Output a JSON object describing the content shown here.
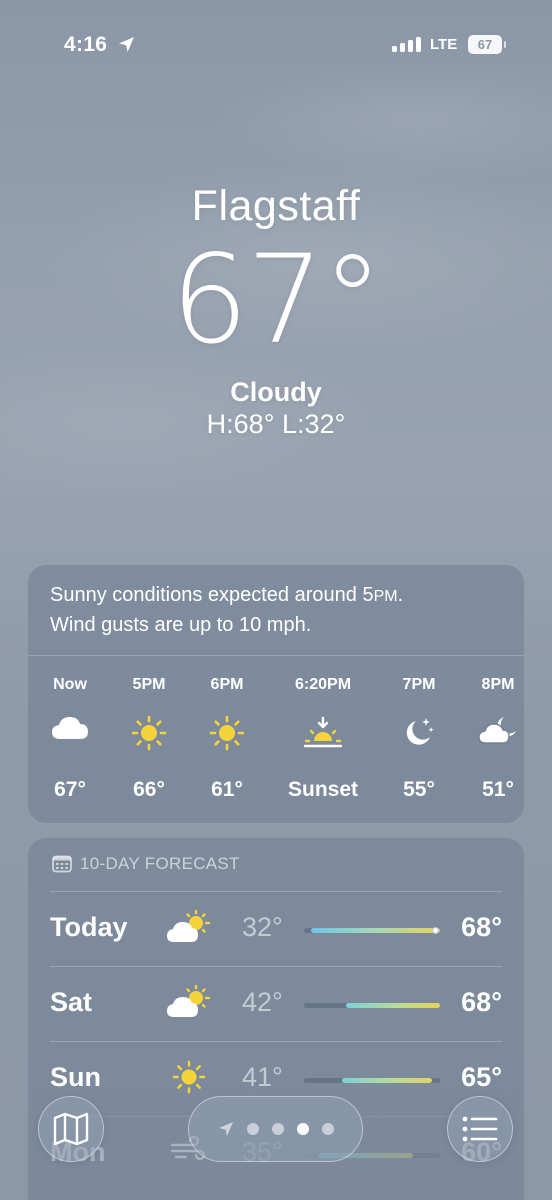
{
  "status_bar": {
    "time": "4:16",
    "network": "LTE",
    "battery": "67"
  },
  "location": {
    "city": "Flagstaff",
    "temperature": "67°",
    "condition": "Cloudy",
    "high_low": "H:68°  L:32°"
  },
  "hourly": {
    "summary_line1_a": "Sunny conditions expected around 5",
    "summary_line1_b": "PM",
    "summary_line1_c": ".",
    "summary_line2": "Wind gusts are up to 10 mph.",
    "hours": [
      {
        "time": "Now",
        "suffix": "",
        "icon": "cloud-icon",
        "temp": "67°"
      },
      {
        "time": "5",
        "suffix": "PM",
        "icon": "sun-icon",
        "temp": "66°"
      },
      {
        "time": "6",
        "suffix": "PM",
        "icon": "sun-icon",
        "temp": "61°"
      },
      {
        "time": "6:20",
        "suffix": "PM",
        "icon": "sunset-icon",
        "temp": "Sunset"
      },
      {
        "time": "7",
        "suffix": "PM",
        "icon": "moon-stars-icon",
        "temp": "55°"
      },
      {
        "time": "8",
        "suffix": "PM",
        "icon": "moon-cloud-icon",
        "temp": "51°"
      }
    ]
  },
  "forecast": {
    "header": "10-DAY FORECAST",
    "days": [
      {
        "day": "Today",
        "icon": "partly-sunny-icon",
        "low": "32°",
        "high": "68°",
        "range_start": 0.05,
        "range_end": 1.0,
        "current": 0.97,
        "colors": [
          "#6ec6e8",
          "#a7d9b8",
          "#e6d25a"
        ]
      },
      {
        "day": "Sat",
        "icon": "partly-sunny-icon",
        "low": "42°",
        "high": "68°",
        "range_start": 0.31,
        "range_end": 1.0,
        "current": null,
        "colors": [
          "#7dd0d8",
          "#b3dba0",
          "#e6d25a"
        ]
      },
      {
        "day": "Sun",
        "icon": "sun-icon",
        "low": "41°",
        "high": "65°",
        "range_start": 0.28,
        "range_end": 0.94,
        "current": null,
        "colors": [
          "#7dd0d8",
          "#b3dba0",
          "#e0d264"
        ]
      },
      {
        "day": "Mon",
        "icon": "wind-icon",
        "low": "35°",
        "high": "60°",
        "range_start": 0.1,
        "range_end": 0.8,
        "current": null,
        "colors": [
          "#6ec6e8",
          "#a7d9b8",
          "#d9d26e"
        ]
      }
    ]
  },
  "colors": {
    "sun": "#f5d33a",
    "accent_white": "#ffffff"
  },
  "page_indicator": {
    "count": 4,
    "active": 2
  }
}
